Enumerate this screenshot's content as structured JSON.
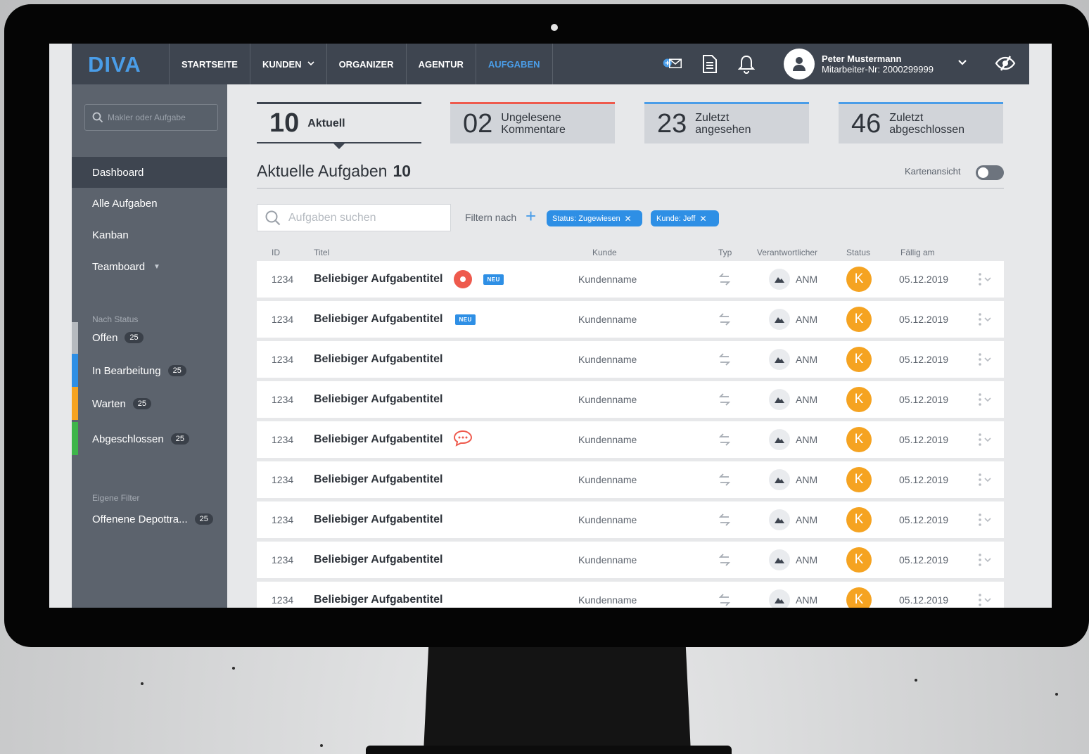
{
  "app": {
    "logo": "DIVA",
    "nav": [
      {
        "label": "STARTSEITE",
        "active": false
      },
      {
        "label": "KUNDEN",
        "active": false,
        "dropdown": true
      },
      {
        "label": "ORGANIZER",
        "active": false
      },
      {
        "label": "AGENTUR",
        "active": false
      },
      {
        "label": "AUFGABEN",
        "active": true
      }
    ],
    "user": {
      "name": "Peter Mustermann",
      "id": "Mitarbeiter-Nr: 2000299999"
    },
    "icons": [
      "mail-add-icon",
      "document-icon",
      "bell-icon",
      "avatar-icon",
      "chevron-down-icon",
      "eye-off-icon"
    ]
  },
  "sidebar": {
    "search_placeholder": "Makler oder Aufgabe",
    "items": [
      {
        "label": "Dashboard",
        "active": true
      },
      {
        "label": "Alle Aufgaben"
      },
      {
        "label": "Kanban"
      },
      {
        "label": "Teamboard"
      }
    ],
    "status_heading": "Nach Status",
    "statuses": [
      {
        "label": "Offen",
        "count": "25",
        "color": "#b6babf"
      },
      {
        "label": "In Bearbeitung",
        "count": "25",
        "color": "#2e8fe5"
      },
      {
        "label": "Warten",
        "count": "25",
        "color": "#f5a321"
      },
      {
        "label": "Abgeschlossen",
        "count": "25",
        "color": "#3eb54a"
      }
    ],
    "filter_heading": "Eigene Filter",
    "filters": [
      {
        "label": "Offenene Depottra...",
        "count": "25"
      }
    ]
  },
  "kpis": [
    {
      "num": "10",
      "label": "Aktuell",
      "selected": true,
      "accent": "#3e4550"
    },
    {
      "num": "02",
      "label": "Ungelesene Kommentare",
      "accent": "#ee5a4d"
    },
    {
      "num": "23",
      "label": "Zuletzt angesehen",
      "accent": "#4a9de8"
    },
    {
      "num": "46",
      "label": "Zuletzt abgeschlossen",
      "accent": "#4a9de8"
    }
  ],
  "section": {
    "title": "Aktuelle Aufgaben",
    "count": "10",
    "toggle_label": "Kartenansicht"
  },
  "filter": {
    "search_placeholder": "Aufgaben suchen",
    "label": "Filtern nach",
    "chips": [
      {
        "label": "Status: Zugewiesen"
      },
      {
        "label": "Kunde: Jeff"
      }
    ]
  },
  "table": {
    "columns": [
      "ID",
      "Titel",
      "Kunde",
      "Typ",
      "Verantwortlicher",
      "Status",
      "Fällig am"
    ],
    "neu_label": "NEU",
    "rows": [
      {
        "id": "1234",
        "title": "Beliebiger Aufgabentitel",
        "kunde": "Kundenname",
        "ver": "ANM",
        "status": "K",
        "date": "05.12.2019",
        "rec": true,
        "neu": true
      },
      {
        "id": "1234",
        "title": "Beliebiger Aufgabentitel",
        "kunde": "Kundenname",
        "ver": "ANM",
        "status": "K",
        "date": "05.12.2019",
        "neu": true
      },
      {
        "id": "1234",
        "title": "Beliebiger Aufgabentitel",
        "kunde": "Kundenname",
        "ver": "ANM",
        "status": "K",
        "date": "05.12.2019"
      },
      {
        "id": "1234",
        "title": "Beliebiger Aufgabentitel",
        "kunde": "Kundenname",
        "ver": "ANM",
        "status": "K",
        "date": "05.12.2019"
      },
      {
        "id": "1234",
        "title": "Beliebiger Aufgabentitel",
        "kunde": "Kundenname",
        "ver": "ANM",
        "status": "K",
        "date": "05.12.2019",
        "comment": true
      },
      {
        "id": "1234",
        "title": "Beliebiger Aufgabentitel",
        "kunde": "Kundenname",
        "ver": "ANM",
        "status": "K",
        "date": "05.12.2019"
      },
      {
        "id": "1234",
        "title": "Beliebiger Aufgabentitel",
        "kunde": "Kundenname",
        "ver": "ANM",
        "status": "K",
        "date": "05.12.2019"
      },
      {
        "id": "1234",
        "title": "Beliebiger Aufgabentitel",
        "kunde": "Kundenname",
        "ver": "ANM",
        "status": "K",
        "date": "05.12.2019"
      },
      {
        "id": "1234",
        "title": "Beliebiger Aufgabentitel",
        "kunde": "Kundenname",
        "ver": "ANM",
        "status": "K",
        "date": "05.12.2019"
      }
    ]
  }
}
